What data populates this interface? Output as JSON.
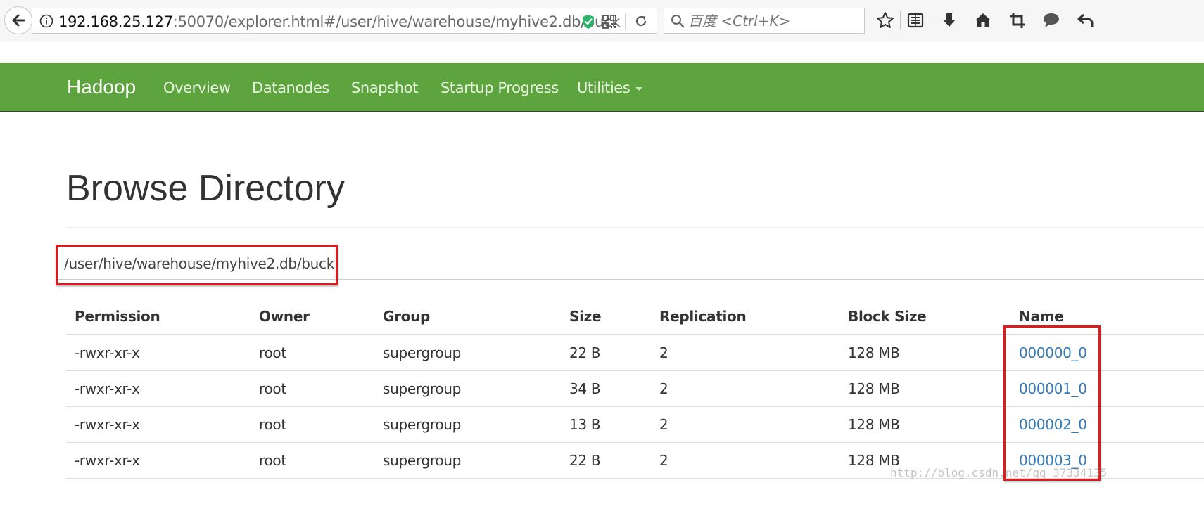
{
  "browser": {
    "url_host": "192.168.25.127",
    "url_rest": ":50070/explorer.html#/user/hive/warehouse/myhive2.db/buck",
    "search_placeholder": "百度 <Ctrl+K>"
  },
  "navbar": {
    "brand": "Hadoop",
    "items": [
      "Overview",
      "Datanodes",
      "Snapshot",
      "Startup Progress",
      "Utilities"
    ],
    "color": "#5ea43e"
  },
  "page": {
    "title": "Browse Directory",
    "path": "/user/hive/warehouse/myhive2.db/buck"
  },
  "table": {
    "headers": [
      "Permission",
      "Owner",
      "Group",
      "Size",
      "Replication",
      "Block Size",
      "Name"
    ],
    "rows": [
      [
        "-rwxr-xr-x",
        "root",
        "supergroup",
        "22 B",
        "2",
        "128 MB",
        "000000_0"
      ],
      [
        "-rwxr-xr-x",
        "root",
        "supergroup",
        "34 B",
        "2",
        "128 MB",
        "000001_0"
      ],
      [
        "-rwxr-xr-x",
        "root",
        "supergroup",
        "13 B",
        "2",
        "128 MB",
        "000002_0"
      ],
      [
        "-rwxr-xr-x",
        "root",
        "supergroup",
        "22 B",
        "2",
        "128 MB",
        "000003_0"
      ]
    ],
    "link_color": "#337ab7"
  },
  "annotation": {
    "highlight_color": "#e01a1a"
  },
  "watermark": "http://blog.csdn.net/qq_37334135"
}
